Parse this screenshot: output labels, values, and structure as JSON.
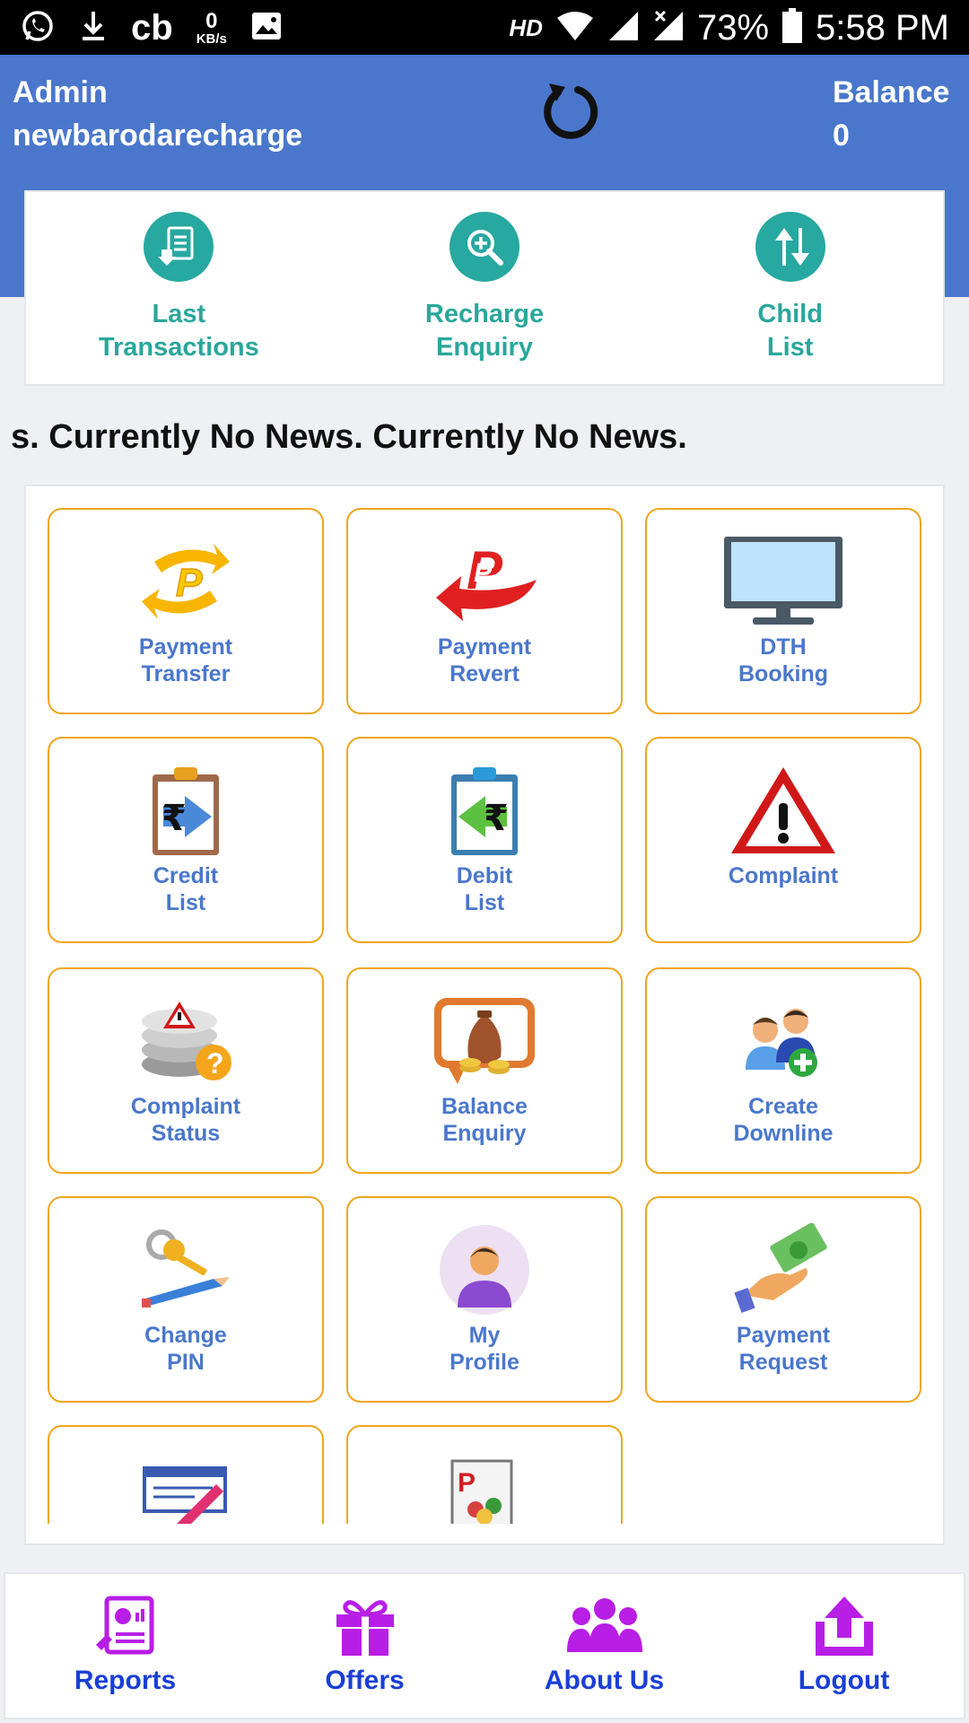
{
  "status_bar": {
    "notification_icons": [
      "whatsapp-icon",
      "download-icon",
      "cb-icon",
      "data-speed-icon",
      "image-icon"
    ],
    "cb_text": "cb",
    "speed_value": "0",
    "speed_unit": "KB/s",
    "network_label": "HD",
    "battery": "73%",
    "time": "5:58 PM"
  },
  "header": {
    "role": "Admin",
    "username": "newbarodarecharge",
    "balance_label": "Balance",
    "balance_value": "0",
    "refresh_icon": "refresh-icon",
    "color": "#4a77cc"
  },
  "quick_actions": [
    {
      "line1": "Last",
      "line2": "Transactions",
      "icon": "document-download-icon"
    },
    {
      "line1": "Recharge",
      "line2": "Enquiry",
      "icon": "magnify-plus-icon"
    },
    {
      "line1": "Child",
      "line2": "List",
      "icon": "up-down-arrows-icon"
    }
  ],
  "news_text": "s. Currently No News. Currently No News.",
  "tiles": [
    {
      "line1": "Payment",
      "line2": "Transfer",
      "icon": "payment-transfer-icon"
    },
    {
      "line1": "Payment",
      "line2": "Revert",
      "icon": "payment-revert-icon"
    },
    {
      "line1": "DTH",
      "line2": "Booking",
      "icon": "monitor-icon"
    },
    {
      "line1": "Credit",
      "line2": "List",
      "icon": "credit-clipboard-icon"
    },
    {
      "line1": "Debit",
      "line2": "List",
      "icon": "debit-clipboard-icon"
    },
    {
      "line1": "Complaint",
      "line2": "",
      "icon": "warning-icon"
    },
    {
      "line1": "Complaint",
      "line2": "Status",
      "icon": "coin-stack-warning-icon"
    },
    {
      "line1": "Balance",
      "line2": "Enquiry",
      "icon": "money-bag-icon"
    },
    {
      "line1": "Create",
      "line2": "Downline",
      "icon": "add-users-icon"
    },
    {
      "line1": "Change",
      "line2": "PIN",
      "icon": "keys-pencil-icon"
    },
    {
      "line1": "My",
      "line2": "Profile",
      "icon": "user-avatar-icon"
    },
    {
      "line1": "Payment",
      "line2": "Request",
      "icon": "hand-cash-icon"
    },
    {
      "line1": "",
      "line2": "",
      "icon": "cheque-pen-icon"
    },
    {
      "line1": "",
      "line2": "",
      "icon": "payment-users-icon"
    }
  ],
  "bottom_nav": [
    {
      "label": "Reports",
      "icon": "report-icon"
    },
    {
      "label": "Offers",
      "icon": "gift-icon"
    },
    {
      "label": "About Us",
      "icon": "group-icon"
    },
    {
      "label": "Logout",
      "icon": "upload-icon"
    }
  ],
  "colors": {
    "accent_blue": "#4a77cc",
    "teal": "#27a8a0",
    "tile_border": "#f0a51c",
    "nav_icon": "#b81ee6",
    "nav_text": "#1a3fd6"
  }
}
